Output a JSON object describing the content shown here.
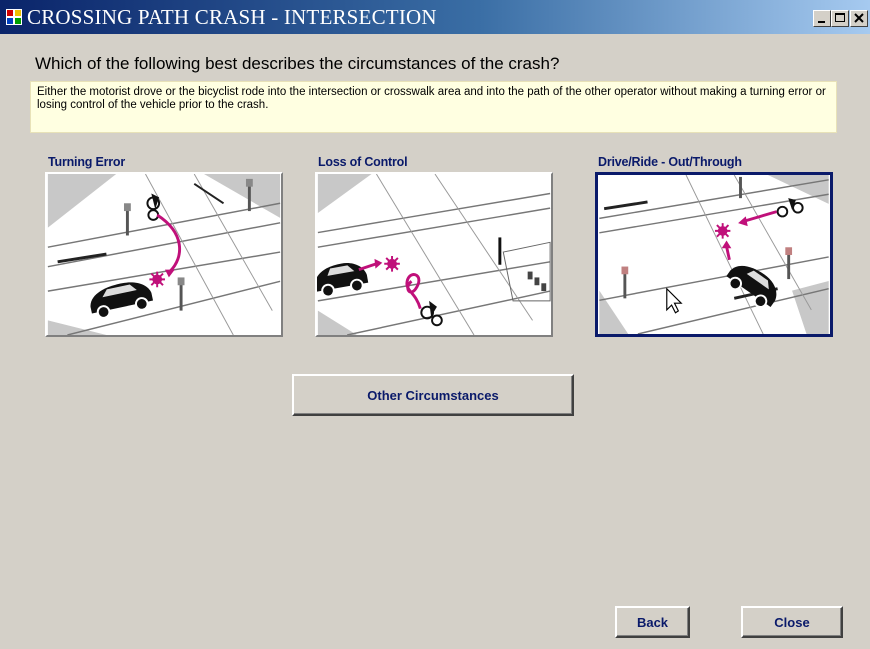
{
  "window": {
    "title": "CROSSING PATH CRASH - INTERSECTION",
    "controls": [
      "minimize-icon",
      "maximize-icon",
      "close-icon"
    ]
  },
  "question": "Which of the following best describes the circumstances of the crash?",
  "description": "Either the motorist drove or the bicyclist rode into the intersection or crosswalk area and into the path of the other operator without making a turning error or losing control of the vehicle prior to the crash.",
  "options": [
    {
      "label": "Turning Error",
      "icon": "turning-error-scene",
      "selected": false
    },
    {
      "label": "Loss of Control",
      "icon": "loss-of-control-scene",
      "selected": false
    },
    {
      "label": "Drive/Ride - Out/Through",
      "icon": "drive-ride-out-through-scene",
      "selected": true
    }
  ],
  "buttons": {
    "other": "Other Circumstances",
    "back": "Back",
    "close": "Close"
  },
  "colors": {
    "accent": "#0a1a6a",
    "crash_marker": "#c0107a",
    "tooltip_bg": "#ffffe1",
    "dialog_bg": "#d4d0c8"
  }
}
